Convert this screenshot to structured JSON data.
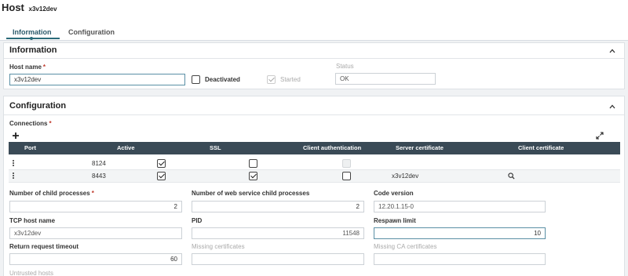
{
  "header": {
    "title": "Host",
    "subtitle": "x3v12dev",
    "tabs": [
      {
        "label": "Information",
        "active": true
      },
      {
        "label": "Configuration",
        "active": false
      }
    ]
  },
  "information": {
    "title": "Information",
    "host_name_label": "Host name",
    "host_name_value": "x3v12dev",
    "deactivated_label": "Deactivated",
    "deactivated_checked": false,
    "started_label": "Started",
    "started_checked": true,
    "status_label": "Status",
    "status_value": "OK"
  },
  "configuration": {
    "title": "Configuration",
    "connections_label": "Connections",
    "table": {
      "columns": [
        "Port",
        "Active",
        "SSL",
        "Client authentication",
        "Server certificate",
        "Client certificate"
      ],
      "rows": [
        {
          "port": "8124",
          "active": true,
          "ssl": false,
          "client_auth": false,
          "server_certificate": "",
          "client_certificate": ""
        },
        {
          "port": "8443",
          "active": true,
          "ssl": true,
          "client_auth": false,
          "server_certificate": "x3v12dev",
          "client_certificate": ""
        }
      ]
    },
    "fields": {
      "child_processes_label": "Number of child processes",
      "child_processes_value": "2",
      "ws_child_processes_label": "Number of web service child processes",
      "ws_child_processes_value": "2",
      "code_version_label": "Code version",
      "code_version_value": "12.20.1.15-0",
      "tcp_host_label": "TCP host name",
      "tcp_host_value": "x3v12dev",
      "pid_label": "PID",
      "pid_value": "11548",
      "respawn_label": "Respawn limit",
      "respawn_value": "10",
      "return_timeout_label": "Return request timeout",
      "return_timeout_value": "60",
      "missing_certs_label": "Missing certificates",
      "missing_certs_value": "",
      "missing_ca_label": "Missing CA certificates",
      "missing_ca_value": "",
      "untrusted_hosts_label": "Untrusted hosts"
    }
  },
  "colors": {
    "accent": "#2b6b7a",
    "table_header": "#3a4a56",
    "required": "#c0392b"
  },
  "icons": {
    "add": "plus-icon",
    "expand": "expand-icon",
    "collapse": "chevron-up-icon",
    "row_menu": "kebab-menu-icon",
    "search": "search-icon"
  }
}
